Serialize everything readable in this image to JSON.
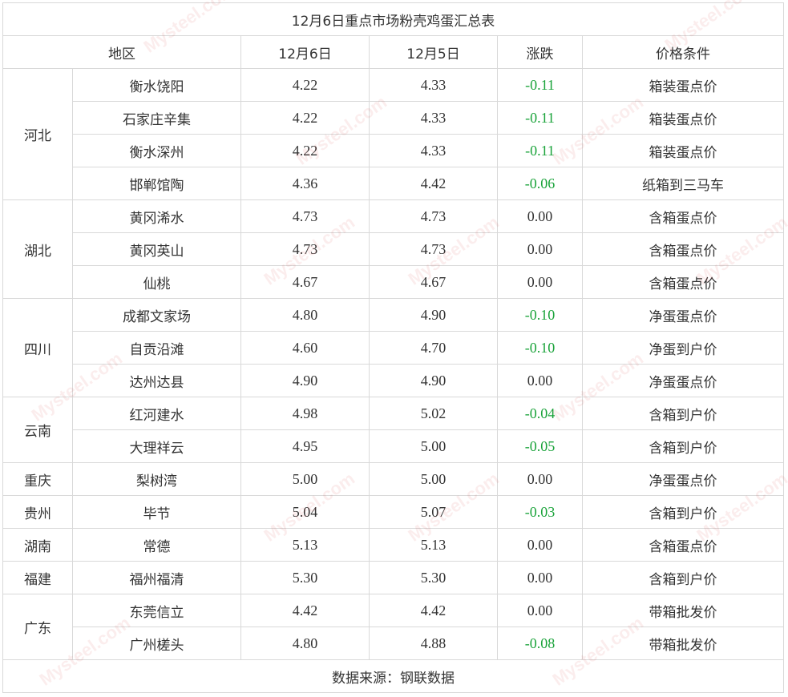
{
  "table": {
    "title": "12月6日重点市场粉壳鸡蛋汇总表",
    "headers": [
      "地区",
      "12月6日",
      "12月5日",
      "涨跌",
      "价格条件"
    ],
    "groups": [
      {
        "region": "河北",
        "rows": [
          {
            "market": "衡水饶阳",
            "dec6": "4.22",
            "dec5": "4.33",
            "change": "-0.11",
            "condition": "箱装蛋点价"
          },
          {
            "market": "石家庄辛集",
            "dec6": "4.22",
            "dec5": "4.33",
            "change": "-0.11",
            "condition": "箱装蛋点价"
          },
          {
            "market": "衡水深州",
            "dec6": "4.22",
            "dec5": "4.33",
            "change": "-0.11",
            "condition": "箱装蛋点价"
          },
          {
            "market": "邯郸馆陶",
            "dec6": "4.36",
            "dec5": "4.42",
            "change": "-0.06",
            "condition": "纸箱到三马车"
          }
        ]
      },
      {
        "region": "湖北",
        "rows": [
          {
            "market": "黄冈浠水",
            "dec6": "4.73",
            "dec5": "4.73",
            "change": "0.00",
            "condition": "含箱蛋点价"
          },
          {
            "market": "黄冈英山",
            "dec6": "4.73",
            "dec5": "4.73",
            "change": "0.00",
            "condition": "含箱蛋点价"
          },
          {
            "market": "仙桃",
            "dec6": "4.67",
            "dec5": "4.67",
            "change": "0.00",
            "condition": "含箱蛋点价"
          }
        ]
      },
      {
        "region": "四川",
        "rows": [
          {
            "market": "成都文家场",
            "dec6": "4.80",
            "dec5": "4.90",
            "change": "-0.10",
            "condition": "净蛋蛋点价"
          },
          {
            "market": "自贡沿滩",
            "dec6": "4.60",
            "dec5": "4.70",
            "change": "-0.10",
            "condition": "净蛋到户价"
          },
          {
            "market": "达州达县",
            "dec6": "4.90",
            "dec5": "4.90",
            "change": "0.00",
            "condition": "净蛋蛋点价"
          }
        ]
      },
      {
        "region": "云南",
        "rows": [
          {
            "market": "红河建水",
            "dec6": "4.98",
            "dec5": "5.02",
            "change": "-0.04",
            "condition": "含箱到户价"
          },
          {
            "market": "大理祥云",
            "dec6": "4.95",
            "dec5": "5.00",
            "change": "-0.05",
            "condition": "含箱到户价"
          }
        ]
      },
      {
        "region": "重庆",
        "rows": [
          {
            "market": "梨树湾",
            "dec6": "5.00",
            "dec5": "5.00",
            "change": "0.00",
            "condition": "净蛋蛋点价"
          }
        ]
      },
      {
        "region": "贵州",
        "rows": [
          {
            "market": "毕节",
            "dec6": "5.04",
            "dec5": "5.07",
            "change": "-0.03",
            "condition": "含箱到户价"
          }
        ]
      },
      {
        "region": "湖南",
        "rows": [
          {
            "market": "常德",
            "dec6": "5.13",
            "dec5": "5.13",
            "change": "0.00",
            "condition": "含箱蛋点价"
          }
        ]
      },
      {
        "region": "福建",
        "rows": [
          {
            "market": "福州福清",
            "dec6": "5.30",
            "dec5": "5.30",
            "change": "0.00",
            "condition": "含箱到户价"
          }
        ]
      },
      {
        "region": "广东",
        "rows": [
          {
            "market": "东莞信立",
            "dec6": "4.42",
            "dec5": "4.42",
            "change": "0.00",
            "condition": "带箱批发价"
          },
          {
            "market": "广州槎头",
            "dec6": "4.80",
            "dec5": "4.88",
            "change": "-0.08",
            "condition": "带箱批发价"
          }
        ]
      }
    ],
    "source": "数据来源：钢联数据"
  },
  "colors": {
    "negative_change": "#1aa33a",
    "border": "#d9d9d9",
    "text": "#333333"
  },
  "watermark": "Mysteel.com"
}
